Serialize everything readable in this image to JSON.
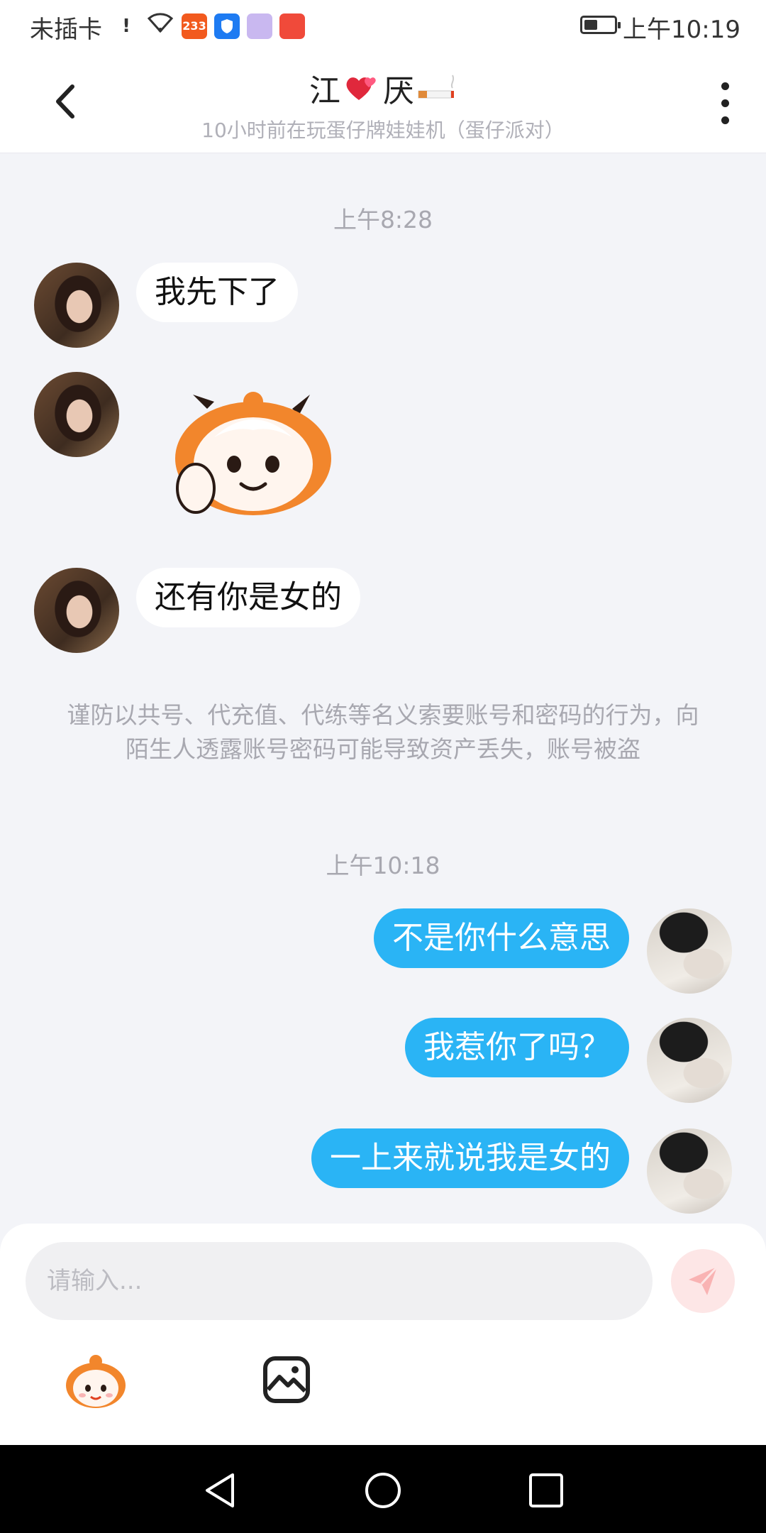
{
  "status_bar": {
    "carrier": "未插卡",
    "app_badge": "233",
    "time": "上午10:19",
    "battery_level": 0.45
  },
  "header": {
    "contact_name": "江",
    "contact_name_suffix": "厌",
    "subtitle": "10小时前在玩蛋仔牌娃娃机（蛋仔派对）"
  },
  "chat": {
    "timestamp_1": "上午8:28",
    "incoming": [
      {
        "text": "我先下了"
      },
      {
        "text": "还有你是女的"
      }
    ],
    "notice": "谨防以共号、代充值、代练等名义索要账号和密码的行为，向陌生人透露账号密码可能导致资产丢失，账号被盗",
    "timestamp_2": "上午10:18",
    "outgoing": [
      {
        "text": "不是你什么意思"
      },
      {
        "text": "我惹你了吗？"
      },
      {
        "text": "一上来就说我是女的"
      }
    ]
  },
  "composer": {
    "placeholder": "请输入..."
  },
  "colors": {
    "outgoing_bubble": "#2ab4f5",
    "incoming_bubble": "#ffffff",
    "background": "#f3f4f8",
    "send_button": "#fde6e6"
  },
  "icons": [
    "back-arrow-icon",
    "more-icon",
    "send-icon",
    "emoji-icon",
    "image-icon",
    "nav-back-icon",
    "nav-home-icon",
    "nav-recents-icon"
  ]
}
